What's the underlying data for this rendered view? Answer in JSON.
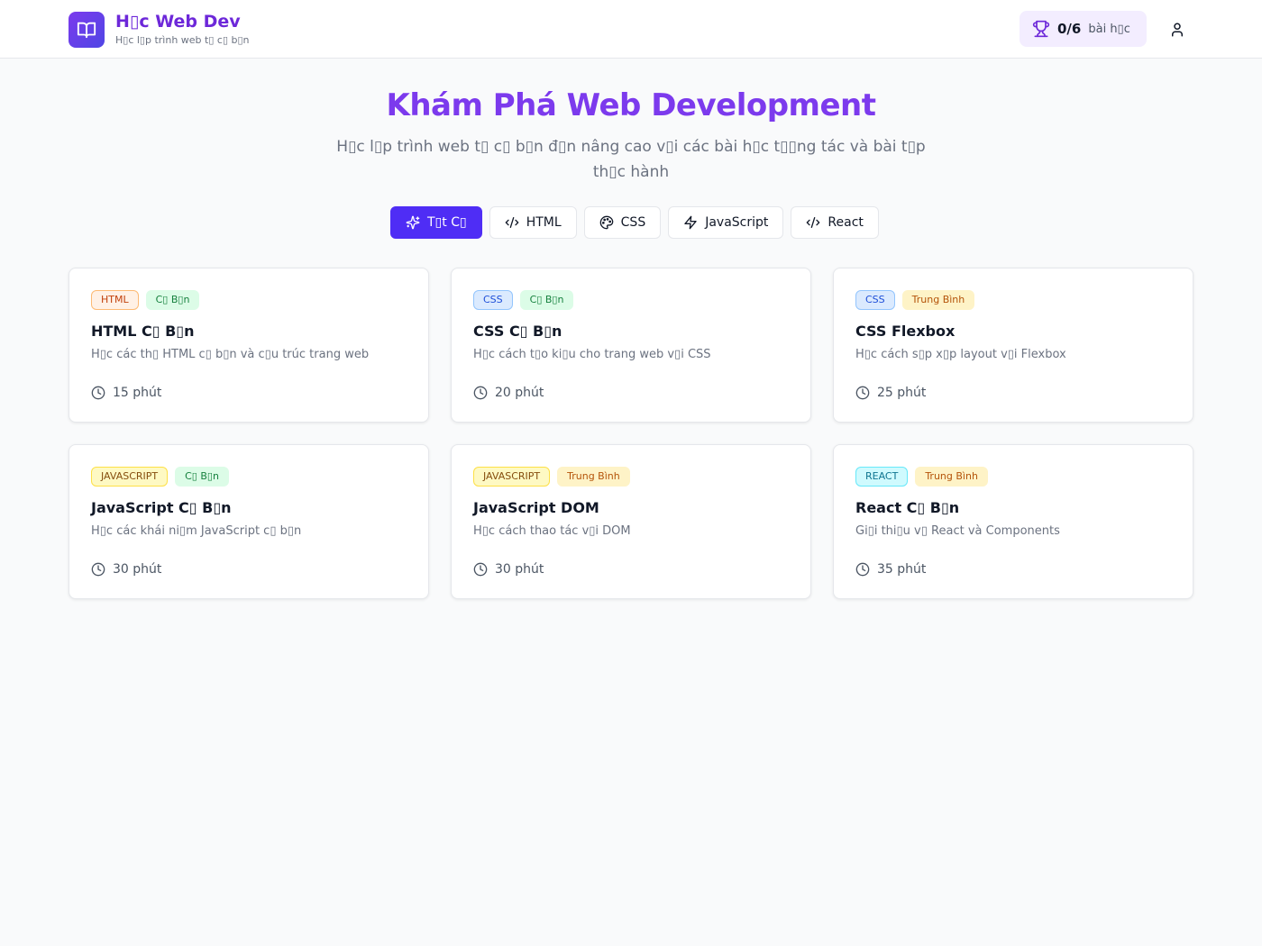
{
  "header": {
    "title": "H▯c Web Dev",
    "subtitle": "H▯c l▯p trình web t▯ c▯ b▯n",
    "progress_count": "0/6",
    "progress_unit": "bài h▯c",
    "icons": {
      "logo": "book-open-icon",
      "progress": "trophy-icon",
      "user": "user-icon"
    },
    "brand_color": "#7c3aed"
  },
  "hero": {
    "title": "Khám Phá Web Development",
    "subtitle": "H▯c l▯p trình web t▯ c▯ b▯n đ▯n nâng cao v▯i các bài h▯c t▯▯ng tác và bài t▯p th▯c hành"
  },
  "filters": [
    {
      "label": "T▯t C▯",
      "icon": "sparkles-icon",
      "active": true
    },
    {
      "label": "HTML",
      "icon": "code-icon",
      "active": false
    },
    {
      "label": "CSS",
      "icon": "palette-icon",
      "active": false
    },
    {
      "label": "JavaScript",
      "icon": "zap-icon",
      "active": false
    },
    {
      "label": "React",
      "icon": "code-icon",
      "active": false
    }
  ],
  "lessons": [
    {
      "category": "HTML",
      "level": "C▯ B▯n",
      "title": "HTML C▯ B▯n",
      "description": "H▯c các th▯ HTML c▯ b▯n và c▯u trúc trang web",
      "duration": "15 phút"
    },
    {
      "category": "CSS",
      "level": "C▯ B▯n",
      "title": "CSS C▯ B▯n",
      "description": "H▯c cách t▯o ki▯u cho trang web v▯i CSS",
      "duration": "20 phút"
    },
    {
      "category": "CSS",
      "level": "Trung Bình",
      "title": "CSS Flexbox",
      "description": "H▯c cách s▯p x▯p layout v▯i Flexbox",
      "duration": "25 phút"
    },
    {
      "category": "JAVASCRIPT",
      "level": "C▯ B▯n",
      "title": "JavaScript C▯ B▯n",
      "description": "H▯c các khái ni▯m JavaScript c▯ b▯n",
      "duration": "30 phút"
    },
    {
      "category": "JAVASCRIPT",
      "level": "Trung Bình",
      "title": "JavaScript DOM",
      "description": "H▯c cách thao tác v▯i DOM",
      "duration": "30 phút"
    },
    {
      "category": "REACT",
      "level": "Trung Bình",
      "title": "React C▯ B▯n",
      "description": "Gi▯i thi▯u v▯ React và Components",
      "duration": "35 phút"
    }
  ]
}
